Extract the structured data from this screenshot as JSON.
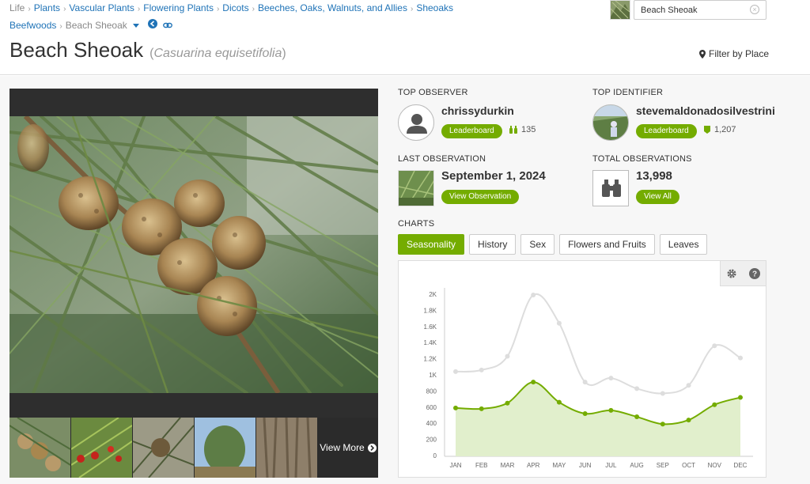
{
  "breadcrumbs": {
    "row1": [
      "Life",
      "Plants",
      "Vascular Plants",
      "Flowering Plants",
      "Dicots",
      "Beeches, Oaks, Walnuts, and Allies",
      "Sheoaks"
    ],
    "row2_link": "Beefwoods",
    "current": "Beach Sheoak"
  },
  "search": {
    "value": "Beach Sheoak",
    "clear_glyph": "×"
  },
  "title": {
    "common": "Beach Sheoak",
    "scientific": "Casuarina equisetifolia",
    "open": "(",
    "close": ")"
  },
  "filter": {
    "label": "Filter by Place"
  },
  "photos": {
    "view_more": "View More"
  },
  "top_observer": {
    "label": "TOP OBSERVER",
    "name": "chrissydurkin",
    "button": "Leaderboard",
    "count": "135"
  },
  "top_identifier": {
    "label": "TOP IDENTIFIER",
    "name": "stevemaldonadosilvestrini",
    "button": "Leaderboard",
    "count": "1,207"
  },
  "last_observation": {
    "label": "LAST OBSERVATION",
    "date": "September 1, 2024",
    "button": "View Observation"
  },
  "total_observations": {
    "label": "TOTAL OBSERVATIONS",
    "count": "13,998",
    "button": "View All"
  },
  "charts": {
    "label": "CHARTS",
    "tabs": [
      "Seasonality",
      "History",
      "Sex",
      "Flowers and Fruits",
      "Leaves"
    ],
    "active_tab": "Seasonality"
  },
  "colors": {
    "accent": "#74ac00",
    "link": "#1f73b7",
    "grey_series": "#dddddd",
    "fill": "#e1efcc"
  },
  "chart_data": {
    "type": "area",
    "categories": [
      "JAN",
      "FEB",
      "MAR",
      "APR",
      "MAY",
      "JUN",
      "JUL",
      "AUG",
      "SEP",
      "OCT",
      "NOV",
      "DEC"
    ],
    "ylim": [
      0,
      2000
    ],
    "yticks": [
      0,
      200,
      400,
      600,
      800,
      1000,
      1200,
      1400,
      1600,
      1800,
      2000
    ],
    "ytick_labels": [
      "0",
      "200",
      "400",
      "600",
      "800",
      "1K",
      "1.2K",
      "1.4K",
      "1.6K",
      "1.8K",
      "2K"
    ],
    "grid": false,
    "series": [
      {
        "values": [
          1040,
          1060,
          1230,
          1990,
          1640,
          910,
          960,
          830,
          770,
          870,
          1360,
          1210
        ]
      },
      {
        "values": [
          590,
          580,
          650,
          910,
          660,
          520,
          560,
          480,
          390,
          440,
          630,
          720
        ]
      }
    ]
  }
}
